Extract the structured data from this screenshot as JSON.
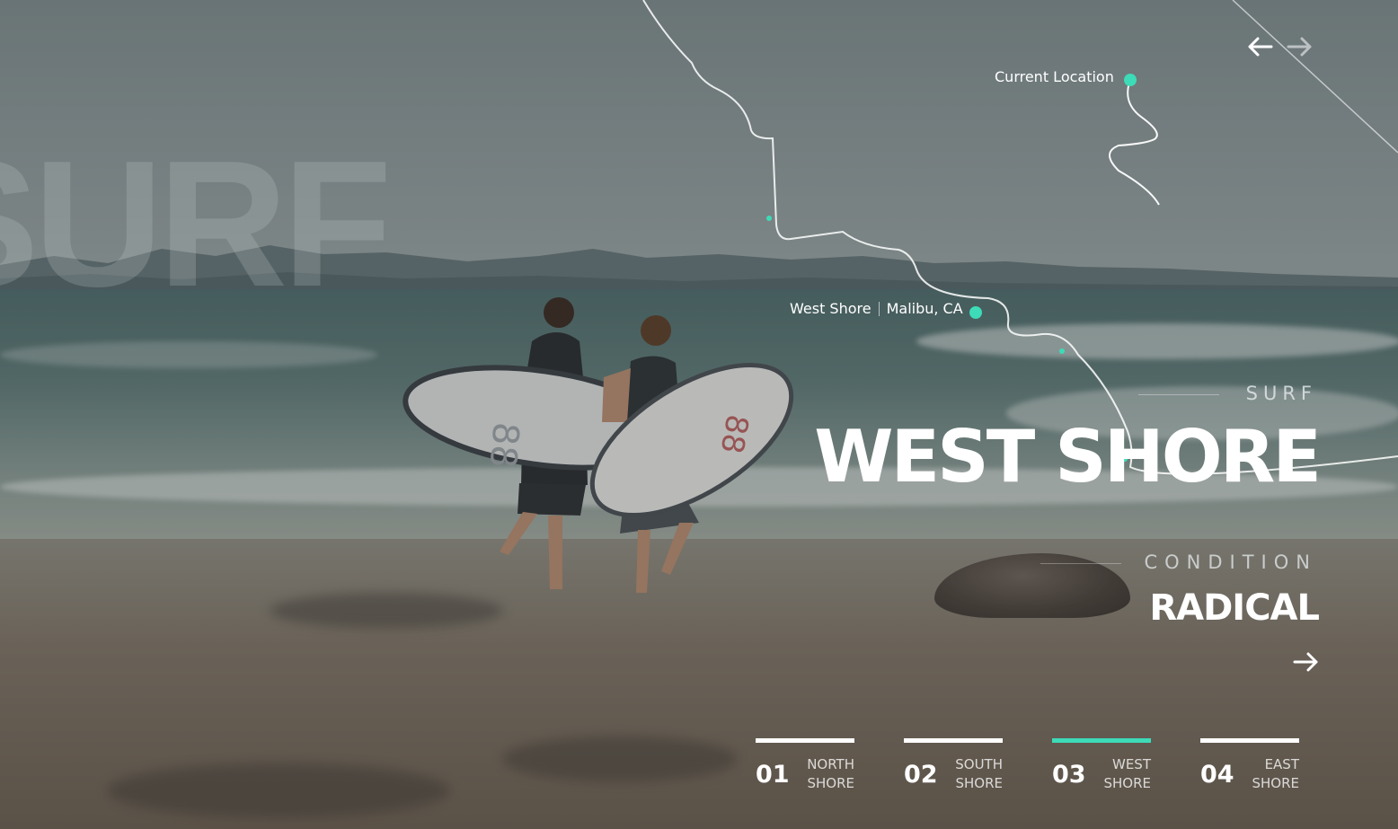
{
  "background": {
    "watermark": "SURF"
  },
  "navigation": {
    "prev_icon": "arrow-left-icon",
    "next_icon": "arrow-right-icon"
  },
  "map": {
    "current_location_label": "Current Location",
    "spot_name": "West Shore",
    "spot_place": "Malibu, CA",
    "accent_color": "#3ddbb8"
  },
  "spot": {
    "category": "SURF",
    "title": "WEST SHORE",
    "condition_label": "CONDITION",
    "condition_value": "RADICAL",
    "go_icon": "arrow-right-icon"
  },
  "pager": {
    "items": [
      {
        "number": "01",
        "line1": "NORTH",
        "line2": "SHORE",
        "active": false
      },
      {
        "number": "02",
        "line1": "SOUTH",
        "line2": "SHORE",
        "active": false
      },
      {
        "number": "03",
        "line1": "WEST",
        "line2": "SHORE",
        "active": true
      },
      {
        "number": "04",
        "line1": "EAST",
        "line2": "SHORE",
        "active": false
      }
    ]
  }
}
